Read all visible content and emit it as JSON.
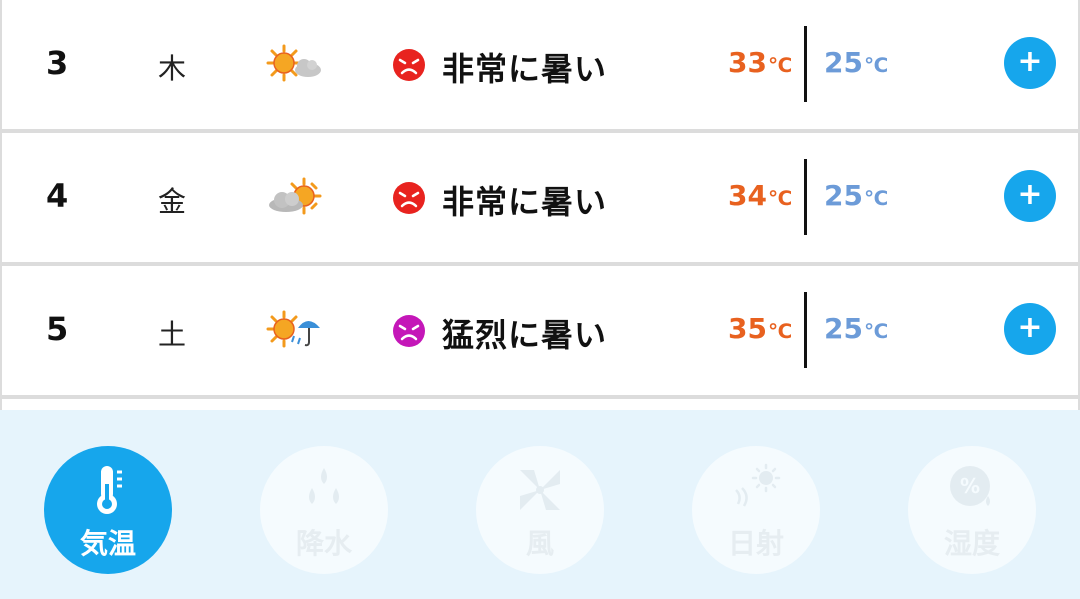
{
  "forecast": [
    {
      "day": "3",
      "weekday": "木",
      "weather_icon": "sun-cloud-icon",
      "face_color": "#e8231f",
      "level": "非常に暑い",
      "high": "33",
      "low": "25",
      "unit": "℃"
    },
    {
      "day": "4",
      "weekday": "金",
      "weather_icon": "cloud-sun-icon",
      "face_color": "#e8231f",
      "level": "非常に暑い",
      "high": "34",
      "low": "25",
      "unit": "℃"
    },
    {
      "day": "5",
      "weekday": "土",
      "weather_icon": "sun-rain-icon",
      "face_color": "#c417b8",
      "level": "猛烈に暑い",
      "high": "35",
      "low": "25",
      "unit": "℃"
    }
  ],
  "expand_label": "+",
  "tabs": [
    {
      "label": "気温",
      "icon": "thermometer-icon",
      "active": true
    },
    {
      "label": "降水",
      "icon": "raindrops-icon",
      "active": false
    },
    {
      "label": "風",
      "icon": "wind-icon",
      "active": false
    },
    {
      "label": "日射",
      "icon": "sunshine-icon",
      "active": false
    },
    {
      "label": "湿度",
      "icon": "humidity-icon",
      "active": false
    }
  ],
  "colors": {
    "accent": "#16a6ec",
    "high_temp": "#e8611f",
    "low_temp": "#6c9bd8",
    "tabbar_bg": "#e6f4fc"
  }
}
